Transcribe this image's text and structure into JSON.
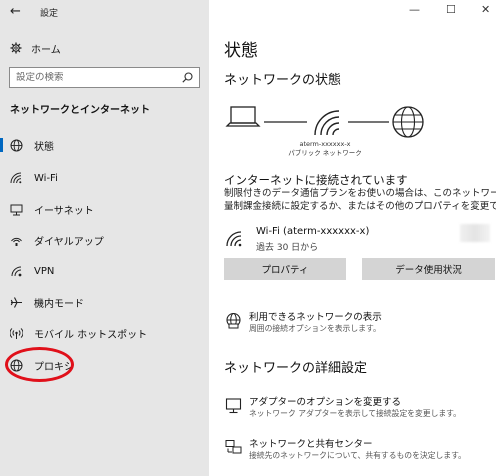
{
  "window": {
    "title": "設定",
    "minimize": "—",
    "maximize": "☐",
    "close": "✕"
  },
  "sidebar": {
    "home_label": "ホーム",
    "search_placeholder": "設定の検索",
    "section_title": "ネットワークとインターネット",
    "items": [
      {
        "label": "状態",
        "icon": "status-globe-icon",
        "active": true
      },
      {
        "label": "Wi-Fi",
        "icon": "wifi-icon"
      },
      {
        "label": "イーサネット",
        "icon": "ethernet-icon"
      },
      {
        "label": "ダイヤルアップ",
        "icon": "dialup-icon"
      },
      {
        "label": "VPN",
        "icon": "vpn-icon"
      },
      {
        "label": "機内モード",
        "icon": "airplane-icon"
      },
      {
        "label": "モバイル ホットスポット",
        "icon": "hotspot-icon"
      },
      {
        "label": "プロキシ",
        "icon": "proxy-globe-icon",
        "highlighted": true
      }
    ]
  },
  "main": {
    "page_title": "状態",
    "network_status_title": "ネットワークの状態",
    "network_name": "aterm-xxxxxx-x",
    "network_type": "パブリック ネットワーク",
    "connected_text": "インターネットに接続されています",
    "description_line1": "制限付きのデータ通信プランをお使いの場合は、このネットワークを従",
    "description_line2": "量制課金接続に設定するか、またはその他のプロパティを変更できます。",
    "wifi": {
      "ssid": "Wi-Fi (aterm-xxxxxx-x)",
      "since": "過去 30 日から"
    },
    "buttons": {
      "properties": "プロパティ",
      "data_usage": "データ使用状況"
    },
    "available_networks": {
      "title": "利用できるネットワークの表示",
      "subtitle": "周囲の接続オプションを表示します。"
    },
    "advanced_title": "ネットワークの詳細設定",
    "adapter_options": {
      "title": "アダプターのオプションを変更する",
      "subtitle": "ネットワーク アダプターを表示して接続設定を変更します。"
    },
    "sharing_center": {
      "title": "ネットワークと共有センター",
      "subtitle": "接続先のネットワークについて、共有するものを決定します。"
    }
  },
  "colors": {
    "sidebar_bg": "#e6e6e6",
    "accent": "#0067c0",
    "highlight_ring": "#e0101a",
    "button_bg": "#d4d4d4"
  }
}
